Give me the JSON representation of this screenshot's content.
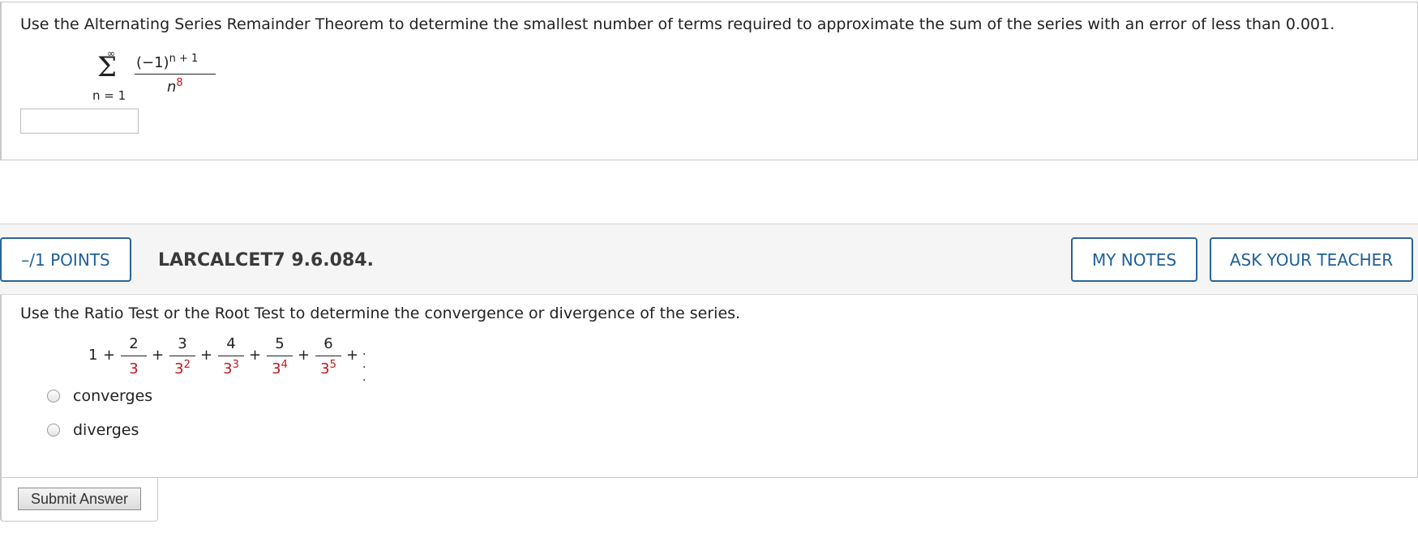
{
  "question1": {
    "prompt": "Use the Alternating Series Remainder Theorem to determine the smallest number of terms required to approximate the sum of the series with an error of less than 0.001.",
    "sum_upper": "∞",
    "sum_symbol": "Σ",
    "sum_lower": "n = 1",
    "numerator_base": "(−1)",
    "numerator_exp": "n + 1",
    "denominator_base": "n",
    "denominator_exp": "8",
    "answer_value": ""
  },
  "header": {
    "points_label": "–/1 POINTS",
    "problem_id": "LARCALCET7 9.6.084.",
    "my_notes_label": "MY NOTES",
    "ask_teacher_label": "ASK YOUR TEACHER"
  },
  "question2": {
    "prompt": "Use the Ratio Test or the Root Test to determine the convergence or divergence of the series.",
    "series": {
      "first_term": "1",
      "terms": [
        {
          "num": "2",
          "den_base": "3",
          "den_exp": ""
        },
        {
          "num": "3",
          "den_base": "3",
          "den_exp": "2"
        },
        {
          "num": "4",
          "den_base": "3",
          "den_exp": "3"
        },
        {
          "num": "5",
          "den_base": "3",
          "den_exp": "4"
        },
        {
          "num": "6",
          "den_base": "3",
          "den_exp": "5"
        }
      ],
      "plus": "+",
      "ellipsis": "· · ·"
    },
    "options": [
      "converges",
      "diverges"
    ]
  },
  "submit": {
    "label": "Submit Answer"
  },
  "colors": {
    "accent_blue": "#1f5f99",
    "math_red": "#c0151b"
  }
}
